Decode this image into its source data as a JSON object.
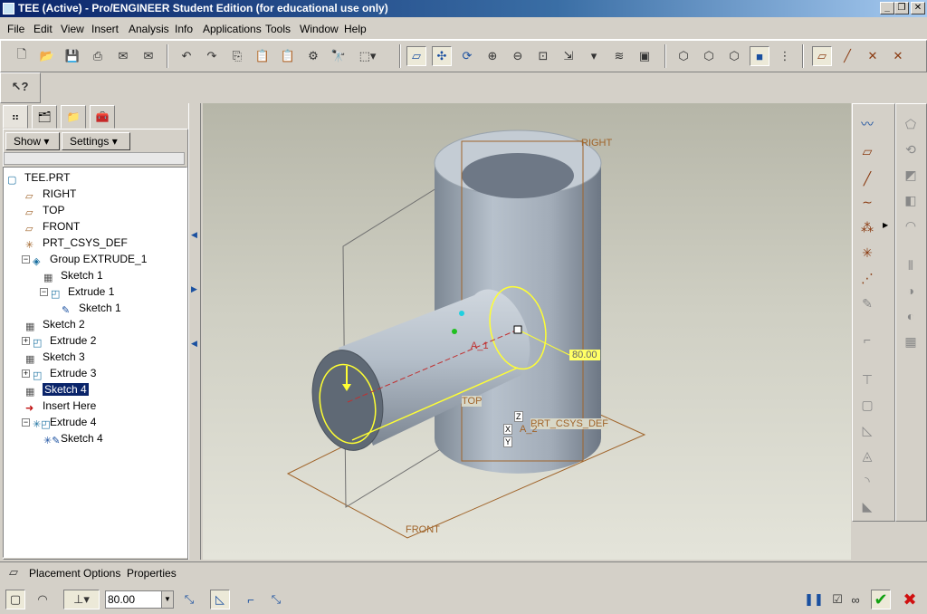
{
  "window": {
    "title": "TEE (Active) - Pro/ENGINEER Student Edition (for educational use only)",
    "buttons": {
      "minimize": "_",
      "restore": "❐",
      "close": "✕"
    }
  },
  "menu": [
    "File",
    "Edit",
    "View",
    "Insert",
    "Analysis",
    "Info",
    "Applications",
    "Tools",
    "Window",
    "Help"
  ],
  "navigator": {
    "show_label": "Show",
    "settings_label": "Settings",
    "tree": [
      {
        "label": "TEE.PRT",
        "icon": "part-icon",
        "level": 0
      },
      {
        "label": "RIGHT",
        "icon": "datum-plane-icon",
        "level": 1
      },
      {
        "label": "TOP",
        "icon": "datum-plane-icon",
        "level": 1
      },
      {
        "label": "FRONT",
        "icon": "datum-plane-icon",
        "level": 1
      },
      {
        "label": "PRT_CSYS_DEF",
        "icon": "csys-icon",
        "level": 1
      },
      {
        "label": "Group EXTRUDE_1",
        "icon": "group-icon",
        "level": 1,
        "expander": "−"
      },
      {
        "label": "Sketch 1",
        "icon": "sketch-icon",
        "level": 2
      },
      {
        "label": "Extrude 1",
        "icon": "extrude-icon",
        "level": 2,
        "expander": "−"
      },
      {
        "label": "Sketch 1",
        "icon": "sketch-edit-icon",
        "level": 3
      },
      {
        "label": "Sketch 2",
        "icon": "sketch-icon",
        "level": 1
      },
      {
        "label": "Extrude 2",
        "icon": "extrude-icon",
        "level": 1,
        "expander": "+"
      },
      {
        "label": "Sketch 3",
        "icon": "sketch-icon",
        "level": 1
      },
      {
        "label": "Extrude 3",
        "icon": "extrude-icon",
        "level": 1,
        "expander": "+"
      },
      {
        "label": "Sketch 4",
        "icon": "sketch-icon",
        "level": 1,
        "selected": true
      },
      {
        "label": "Insert Here",
        "icon": "insert-here-arrow-icon",
        "level": 1
      },
      {
        "label": "Extrude 4",
        "icon": "extrude-icon",
        "level": 1,
        "expander": "−",
        "marker": "✳"
      },
      {
        "label": "Sketch 4",
        "icon": "sketch-edit-icon",
        "level": 2,
        "marker": "✳"
      }
    ]
  },
  "viewport": {
    "datum_labels": {
      "right": "RIGHT",
      "top": "TOP",
      "front": "FRONT",
      "csys": "PRT_CSYS_DEF",
      "axis1": "A_1",
      "axis2": "A_2",
      "x": "X",
      "y": "Y",
      "z": "Z"
    },
    "depth_value": "80.00"
  },
  "dashboard": {
    "tabs": [
      "Placement",
      "Options",
      "Properties"
    ],
    "depth_input": "80.00"
  },
  "colors": {
    "accent": "#0a246a",
    "datum": "#a0642a",
    "sketch": "#ffff00",
    "model": "#aeb8c4"
  }
}
